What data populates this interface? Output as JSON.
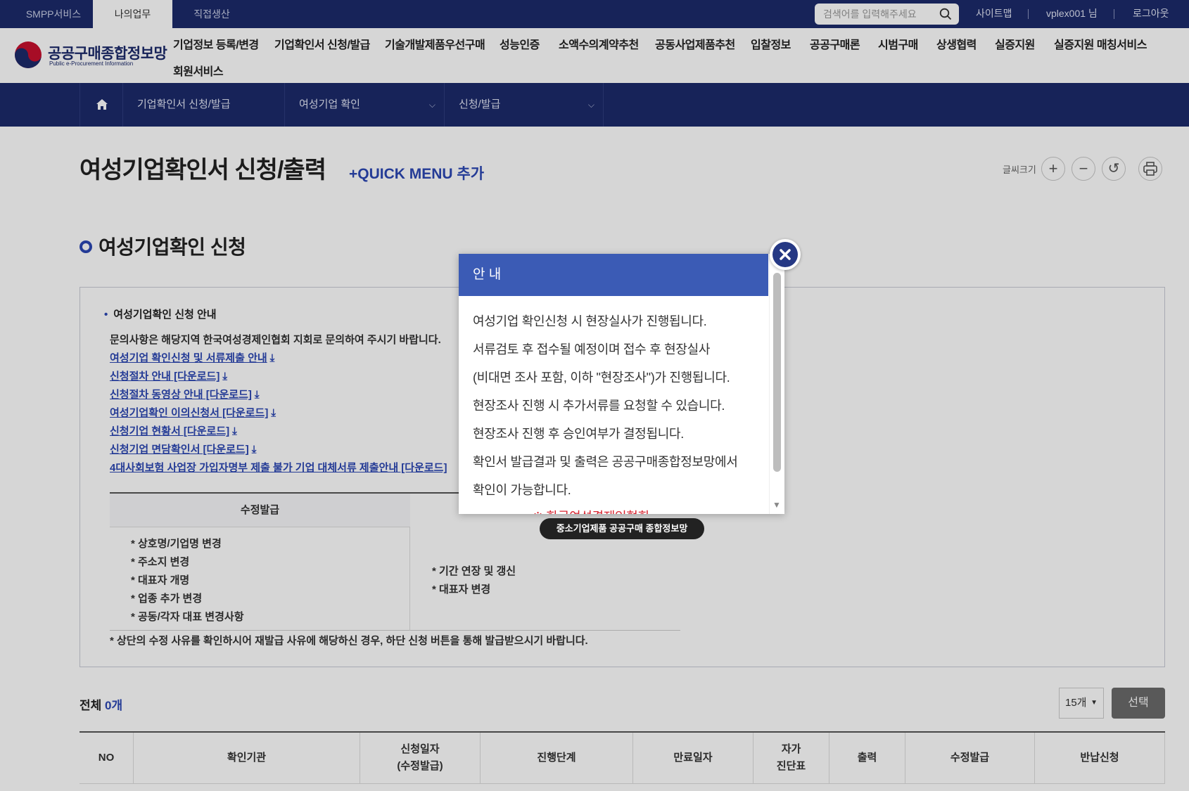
{
  "topbar": {
    "tabs": [
      "SMPP서비스",
      "나의업무",
      "직접생산"
    ],
    "search_placeholder": "검색어를 입력해주세요",
    "links": [
      "사이트맵",
      "vplex001 님",
      "로그아웃"
    ]
  },
  "logo": {
    "name_ko": "공공구매종합정보망",
    "name_en": "Public e-Procurement Information"
  },
  "gnb": [
    "기업정보 등록/변경",
    "기업확인서 신청/발급",
    "기술개발제품우선구매",
    "성능인증",
    "소액수의계약추천",
    "공동사업제품추천",
    "입찰정보",
    "공공구매론",
    "시범구매",
    "상생협력",
    "실증지원",
    "실증지원 매칭서비스",
    "회원서비스"
  ],
  "location": {
    "items": [
      "기업확인서 신청/발급",
      "여성기업 확인",
      "신청/발급"
    ]
  },
  "page": {
    "title": "여성기업확인서 신청/출력",
    "quick_menu": "+QUICK MENU 추가",
    "font_size_label": "글씨크기",
    "font_buttons": [
      "+",
      "−",
      "↺"
    ]
  },
  "section": {
    "title": "여성기업확인 신청"
  },
  "info": {
    "heading": "여성기업확인 신청 안내",
    "desc": "문의사항은 해당지역 한국여성경제인협회 지회로 문의하여 주시기 바랍니다.",
    "links": [
      "여성기업 확인신청 및 서류제출 안내",
      "신청절차 안내 [다운로드]",
      "신청절차 동영상 안내 [다운로드]",
      "여성기업확인 이의신청서 [다운로드]",
      "신청기업 현황서 [다운로드]",
      "신청기업 면담확인서 [다운로드]",
      "4대사회보험 사업장 가입자명부 제출 불가 기업 대체서류 제출안내 [다운로드]"
    ],
    "table_header_left": "수정발급",
    "left_items": [
      "* 상호명/기업명 변경",
      "* 주소지 변경",
      "* 대표자 개명",
      "* 업종 추가 변경",
      "* 공동/각자 대표 변경사항"
    ],
    "right_items": [
      "* 기간 연장 및 갱신",
      "* 대표자 변경"
    ],
    "note": "* 상단의 수정 사유를 확인하시어 재발급 사유에 해당하신 경우, 하단 신청 버튼을 통해 발급받으시기 바랍니다."
  },
  "list": {
    "total_label": "전체",
    "total_count": "0개",
    "page_size": "15개",
    "select_button": "선택",
    "columns": [
      "NO",
      "확인기관",
      "신청일자\n(수정발급)",
      "진행단계",
      "만료일자",
      "자가\n진단표",
      "출력",
      "수정발급",
      "반납신청"
    ]
  },
  "modal": {
    "title": "안 내",
    "lines": [
      "여성기업 확인신청 시 현장실사가 진행됩니다.",
      "서류검토 후 접수될 예정이며 접수 후 현장실사",
      "(비대면 조사 포함, 이하 \"현장조사\")가 진행됩니다.",
      "현장조사 진행 시 추가서류를 요청할 수 있습니다.",
      "현장조사 진행 후 승인여부가 결정됩니다.",
      "확인서 발급결과 및 출력은 공공구매종합정보망에서",
      "확인이 가능합니다."
    ],
    "partial_line": "※ 한국여성경제인협회"
  },
  "tooltip": "중소기업제품 공공구매 종합정보망",
  "colors": {
    "navy": "#1c2a6b",
    "accent": "#2c47b3",
    "modal_header": "#3b5bb5"
  }
}
